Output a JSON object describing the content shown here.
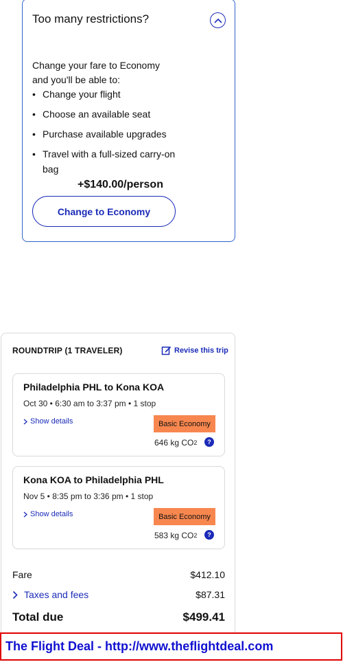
{
  "upsell": {
    "title": "Too many restrictions?",
    "intro": "Change your fare to Economy and you'll be able to:",
    "benefits": [
      "Change your flight",
      "Choose an available seat",
      "Purchase available upgrades",
      "Travel with a full-sized carry-on bag"
    ],
    "price": "+$140.00/person",
    "button_label": "Change to Economy"
  },
  "trip": {
    "header": "ROUNDTRIP (1 TRAVELER)",
    "revise_label": "Revise this trip",
    "flights": [
      {
        "route": "Philadelphia PHL to Kona KOA",
        "times": "Oct 30 • 6:30 am to 3:37 pm • 1 stop",
        "show_details": "Show details",
        "fare_class": "Basic Economy",
        "emissions": "646 kg CO",
        "emissions_sub": "2"
      },
      {
        "route": "Kona KOA to Philadelphia PHL",
        "times": "Nov 5 • 8:35 pm to 3:36 pm • 1 stop",
        "show_details": "Show details",
        "fare_class": "Basic Economy",
        "emissions": "583 kg CO",
        "emissions_sub": "2"
      }
    ],
    "fare_label": "Fare",
    "fare_value": "$412.10",
    "taxes_label": "Taxes and fees",
    "taxes_value": "$87.31",
    "total_label": "Total due",
    "total_value": "$499.41"
  },
  "banner": {
    "text": "The Flight Deal - http://www.theflightdeal.com"
  },
  "colors": {
    "accent_blue": "#1b2bb8",
    "upsell_border": "#2f63c9",
    "basic_economy_badge": "#f7874f",
    "banner_border": "#e00000",
    "banner_text": "#1010d0"
  },
  "icons": {
    "collapse": "chevron-up-icon",
    "revise": "edit-icon",
    "show_details": "chevron-right-icon",
    "help": "help-icon",
    "taxes": "chevron-right-icon"
  }
}
